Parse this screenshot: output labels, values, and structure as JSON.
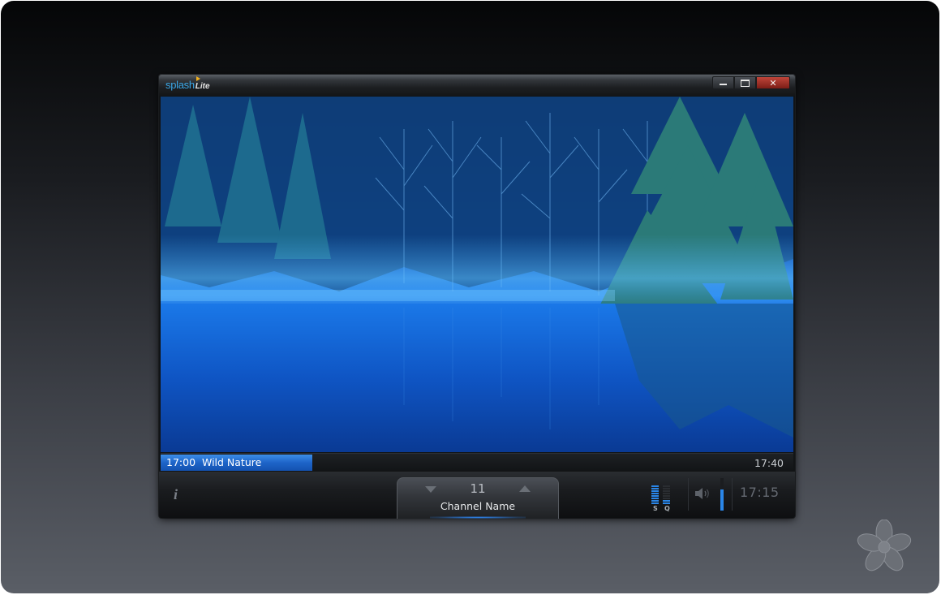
{
  "app": {
    "name_part1": "splash",
    "name_part2": "Lite"
  },
  "window_controls": {
    "minimize": "minimize",
    "maximize": "maximize",
    "close": "✕"
  },
  "program": {
    "start_time": "17:00",
    "title": "Wild Nature",
    "end_time": "17:40",
    "progress_fraction": 0.24
  },
  "channel": {
    "number": "11",
    "name": "Channel Name"
  },
  "signal": {
    "s_label": "S",
    "q_label": "Q",
    "s_level": 1.0,
    "q_level": 0.3
  },
  "volume": {
    "level": 0.65
  },
  "clock": "17:15",
  "info_label": "i",
  "colors": {
    "accent": "#2a86e8",
    "progress": "#1e64c8",
    "close_button": "#a8342a"
  }
}
